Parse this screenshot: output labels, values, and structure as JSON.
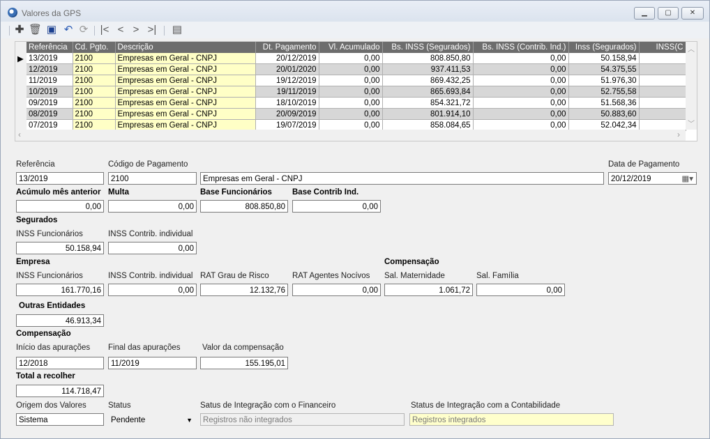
{
  "window": {
    "title": "Valores da GPS"
  },
  "toolbar": {
    "buttons": [
      "add-icon",
      "delete-icon",
      "save-icon",
      "undo-icon",
      "refresh-icon",
      "first-icon",
      "previous-icon",
      "next-icon",
      "last-icon",
      "report-icon"
    ]
  },
  "grid": {
    "columns": [
      "Referência",
      "Cd. Pgto.",
      "Descrição",
      "Dt. Pagamento",
      "Vl. Acumulado",
      "Bs. INSS (Segurados)",
      "Bs. INSS (Contrib. Ind.)",
      "Inss (Segurados)",
      "INSS(C"
    ],
    "rows": [
      {
        "ref": "13/2019",
        "cd": "2100",
        "desc": "Empresas em Geral - CNPJ",
        "dt": "20/12/2019",
        "acum": "0,00",
        "bs": "808.850,80",
        "bsci": "0,00",
        "inss": "50.158,94"
      },
      {
        "ref": "12/2019",
        "cd": "2100",
        "desc": "Empresas em Geral - CNPJ",
        "dt": "20/01/2020",
        "acum": "0,00",
        "bs": "937.411,53",
        "bsci": "0,00",
        "inss": "54.375,55"
      },
      {
        "ref": "11/2019",
        "cd": "2100",
        "desc": "Empresas em Geral - CNPJ",
        "dt": "19/12/2019",
        "acum": "0,00",
        "bs": "869.432,25",
        "bsci": "0,00",
        "inss": "51.976,30"
      },
      {
        "ref": "10/2019",
        "cd": "2100",
        "desc": "Empresas em Geral - CNPJ",
        "dt": "19/11/2019",
        "acum": "0,00",
        "bs": "865.693,84",
        "bsci": "0,00",
        "inss": "52.755,58"
      },
      {
        "ref": "09/2019",
        "cd": "2100",
        "desc": "Empresas em Geral - CNPJ",
        "dt": "18/10/2019",
        "acum": "0,00",
        "bs": "854.321,72",
        "bsci": "0,00",
        "inss": "51.568,36"
      },
      {
        "ref": "08/2019",
        "cd": "2100",
        "desc": "Empresas em Geral - CNPJ",
        "dt": "20/09/2019",
        "acum": "0,00",
        "bs": "801.914,10",
        "bsci": "0,00",
        "inss": "50.883,60"
      },
      {
        "ref": "07/2019",
        "cd": "2100",
        "desc": "Empresas em Geral - CNPJ",
        "dt": "19/07/2019",
        "acum": "0,00",
        "bs": "858.084,65",
        "bsci": "0,00",
        "inss": "52.042,34"
      }
    ]
  },
  "form": {
    "referencia": {
      "label": "Referência",
      "value": "13/2019"
    },
    "codigo": {
      "label": "Código de Pagamento",
      "value": "2100",
      "desc": "Empresas em Geral - CNPJ"
    },
    "data_pagamento": {
      "label": "Data de Pagamento",
      "value": "20/12/2019"
    },
    "acumulo": {
      "label": "Acúmulo mês anterior",
      "value": "0,00"
    },
    "multa": {
      "label": "Multa",
      "value": "0,00"
    },
    "base_func": {
      "label": "Base Funcionários",
      "value": "808.850,80"
    },
    "base_contrib": {
      "label": "Base Contrib Ind.",
      "value": "0,00"
    },
    "segurados": {
      "title": "Segurados",
      "inss_func_label": "INSS Funcionários",
      "inss_func": "50.158,94",
      "inss_contrib_label": "INSS Contrib. individual",
      "inss_contrib": "0,00"
    },
    "empresa": {
      "title": "Empresa",
      "inss_func_label": "INSS Funcionários",
      "inss_func": "161.770,16",
      "inss_contrib_label": "INSS Contrib. individual",
      "inss_contrib": "0,00",
      "rat_label": "RAT Grau de Risco",
      "rat": "12.132,76",
      "rat_ag_label": "RAT Agentes Nocívos",
      "rat_ag": "0,00"
    },
    "compensacao_emp": {
      "title": "Compensação",
      "sal_mat_label": "Sal. Maternidade",
      "sal_mat": "1.061,72",
      "sal_fam_label": "Sal. Família",
      "sal_fam": "0,00"
    },
    "outras": {
      "label": "Outras Entidades",
      "value": "46.913,34"
    },
    "compensacao": {
      "title": "Compensação",
      "inicio_label": "Início das apurações",
      "inicio": "12/2018",
      "final_label": "Final das apurações",
      "final": "11/2019",
      "valor_label": "Valor da compensação",
      "valor": "155.195,01"
    },
    "total": {
      "label": "Total a recolher",
      "value": "114.718,47"
    },
    "origem": {
      "label": "Origem dos Valores",
      "value": "Sistema"
    },
    "status": {
      "label": "Status",
      "value": "Pendente"
    },
    "status_fin": {
      "label": "Satus de Integração com o Financeiro",
      "value": "Registros não integrados"
    },
    "status_cont": {
      "label": "Status de Integração com a Contabilidade",
      "value": "Registros integrados"
    }
  }
}
